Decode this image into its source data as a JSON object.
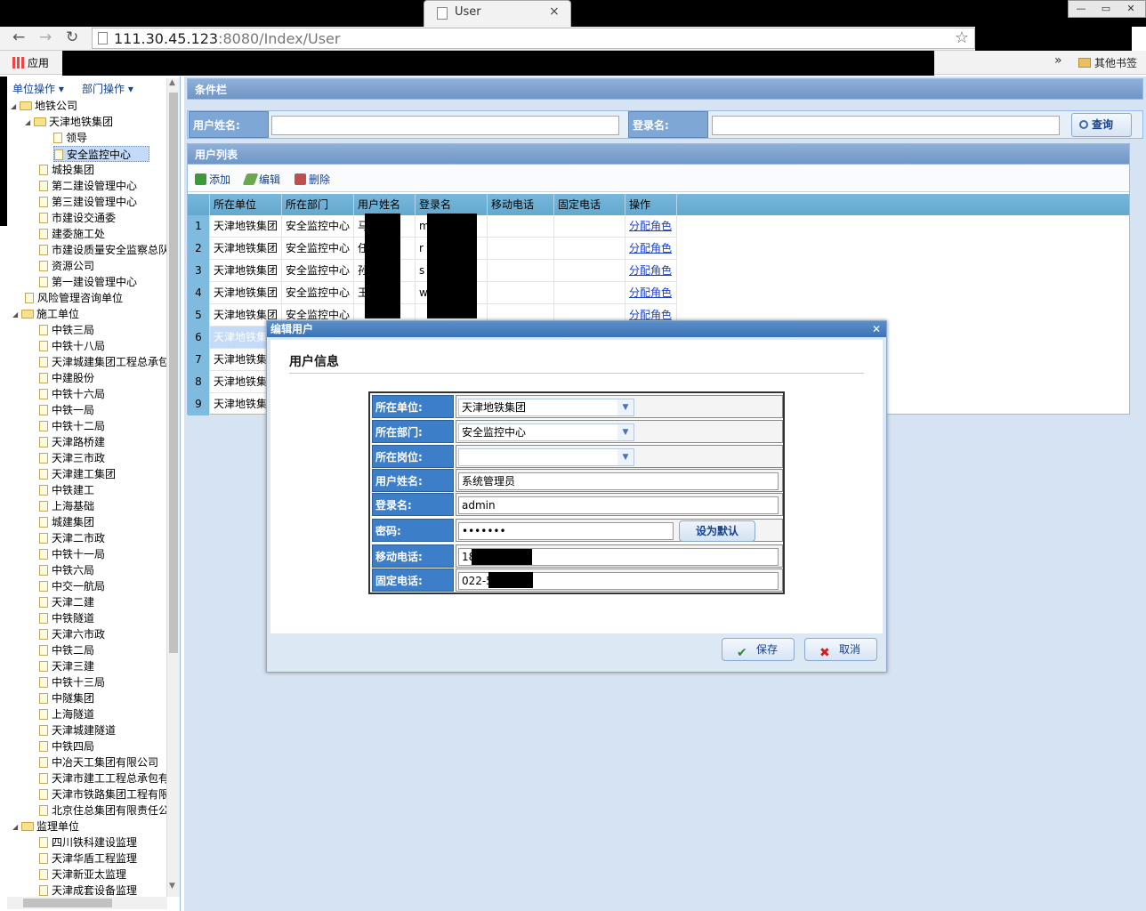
{
  "browser": {
    "tab_title": "User",
    "tab_close": "×",
    "url_host": "111.30.45.123",
    "url_rest": ":8080/Index/User",
    "apps_label": "应用",
    "more": "»",
    "other_bookmarks": "其他书签",
    "win_min": "—",
    "win_max": "▭",
    "win_close": "✕"
  },
  "left": {
    "unit_ops": "单位操作 ▾",
    "dept_ops": "部门操作 ▾",
    "tree": [
      {
        "label": "地铁公司",
        "type": "folder",
        "toggle": "◢"
      },
      {
        "label": "天津地铁集团",
        "type": "folder",
        "toggle": "◢"
      },
      {
        "label": "领导",
        "type": "page"
      },
      {
        "label": "安全监控中心",
        "type": "page",
        "selected": true
      },
      {
        "label": "城投集团",
        "type": "page"
      },
      {
        "label": "第二建设管理中心",
        "type": "page"
      },
      {
        "label": "第三建设管理中心",
        "type": "page"
      },
      {
        "label": "市建设交通委",
        "type": "page"
      },
      {
        "label": "建委施工处",
        "type": "page"
      },
      {
        "label": "市建设质量安全监察总队",
        "type": "page"
      },
      {
        "label": "资源公司",
        "type": "page"
      },
      {
        "label": "第一建设管理中心",
        "type": "page"
      },
      {
        "label": "风险管理咨询单位",
        "type": "page"
      },
      {
        "label": "施工单位",
        "type": "folder",
        "toggle": "◢"
      },
      {
        "label": "中铁三局",
        "type": "page"
      },
      {
        "label": "中铁十八局",
        "type": "page"
      },
      {
        "label": "天津城建集团工程总承包",
        "type": "page"
      },
      {
        "label": "中建股份",
        "type": "page"
      },
      {
        "label": "中铁十六局",
        "type": "page"
      },
      {
        "label": "中铁一局",
        "type": "page"
      },
      {
        "label": "中铁十二局",
        "type": "page"
      },
      {
        "label": "天津路桥建",
        "type": "page"
      },
      {
        "label": "天津三市政",
        "type": "page"
      },
      {
        "label": "天津建工集团",
        "type": "page"
      },
      {
        "label": "中铁建工",
        "type": "page"
      },
      {
        "label": "上海基础",
        "type": "page"
      },
      {
        "label": "城建集团",
        "type": "page"
      },
      {
        "label": "天津二市政",
        "type": "page"
      },
      {
        "label": "中铁十一局",
        "type": "page"
      },
      {
        "label": "中铁六局",
        "type": "page"
      },
      {
        "label": "中交一航局",
        "type": "page"
      },
      {
        "label": "天津二建",
        "type": "page"
      },
      {
        "label": "中铁隧道",
        "type": "page"
      },
      {
        "label": "天津六市政",
        "type": "page"
      },
      {
        "label": "中铁二局",
        "type": "page"
      },
      {
        "label": "天津三建",
        "type": "page"
      },
      {
        "label": "中铁十三局",
        "type": "page"
      },
      {
        "label": "中隧集团",
        "type": "page"
      },
      {
        "label": "上海隧道",
        "type": "page"
      },
      {
        "label": "天津城建隧道",
        "type": "page"
      },
      {
        "label": "中铁四局",
        "type": "page"
      },
      {
        "label": "中冶天工集团有限公司",
        "type": "page"
      },
      {
        "label": "天津市建工工程总承包有",
        "type": "page"
      },
      {
        "label": "天津市铁路集团工程有限",
        "type": "page"
      },
      {
        "label": "北京住总集团有限责任公",
        "type": "page"
      },
      {
        "label": "监理单位",
        "type": "folder",
        "toggle": "◢"
      },
      {
        "label": "四川铁科建设监理",
        "type": "page"
      },
      {
        "label": "天津华盾工程监理",
        "type": "page"
      },
      {
        "label": "天津新亚太监理",
        "type": "page"
      },
      {
        "label": "天津成套设备监理",
        "type": "page"
      }
    ]
  },
  "conditions": {
    "title": "条件栏",
    "name_label": "用户姓名:",
    "name_value": "",
    "login_label": "登录名:",
    "login_value": "",
    "search_label": "查询"
  },
  "grid": {
    "title": "用户列表",
    "add": "添加",
    "edit": "编辑",
    "delete": "删除",
    "columns": [
      "所在单位",
      "所在部门",
      "用户姓名",
      "登录名",
      "移动电话",
      "固定电话",
      "操作"
    ],
    "rows": [
      {
        "n": "1",
        "unit": "天津地铁集团",
        "dept": "安全监控中心",
        "name": "马",
        "login": "m",
        "mobile": "",
        "phone": "",
        "op": "分配角色"
      },
      {
        "n": "2",
        "unit": "天津地铁集团",
        "dept": "安全监控中心",
        "name": "任",
        "login": "r",
        "mobile": "",
        "phone": "",
        "op": "分配角色"
      },
      {
        "n": "3",
        "unit": "天津地铁集团",
        "dept": "安全监控中心",
        "name": "孙",
        "login": "s",
        "mobile": "",
        "phone": "",
        "op": "分配角色"
      },
      {
        "n": "4",
        "unit": "天津地铁集团",
        "dept": "安全监控中心",
        "name": "王",
        "login": "w",
        "mobile": "",
        "phone": "",
        "op": "分配角色"
      },
      {
        "n": "5",
        "unit": "天津地铁集团",
        "dept": "安全监控中心",
        "name": "",
        "login": "",
        "mobile": "",
        "phone": "",
        "op": "分配角色"
      },
      {
        "n": "6",
        "unit": "天津地铁集",
        "dept": "",
        "name": "",
        "login": "",
        "mobile": "",
        "phone": "",
        "op": ""
      },
      {
        "n": "7",
        "unit": "天津地铁集",
        "dept": "",
        "name": "",
        "login": "",
        "mobile": "",
        "phone": "",
        "op": ""
      },
      {
        "n": "8",
        "unit": "天津地铁集",
        "dept": "",
        "name": "",
        "login": "",
        "mobile": "",
        "phone": "",
        "op": ""
      },
      {
        "n": "9",
        "unit": "天津地铁集",
        "dept": "",
        "name": "",
        "login": "",
        "mobile": "",
        "phone": "",
        "op": ""
      }
    ]
  },
  "dialog": {
    "title": "编辑用户",
    "close": "✕",
    "section": "用户信息",
    "unit_label": "所在单位:",
    "unit_value": "天津地铁集团",
    "dept_label": "所在部门:",
    "dept_value": "安全监控中心",
    "post_label": "所在岗位:",
    "post_value": "",
    "name_label": "用户姓名:",
    "name_value": "系统管理员",
    "login_label": "登录名:",
    "login_value": "admin",
    "pwd_label": "密码:",
    "pwd_value": "•••••••",
    "default_btn": "设为默认",
    "mobile_label": "移动电话:",
    "mobile_value": "18",
    "phone_label": "固定电话:",
    "phone_value": "022-58",
    "save": "保存",
    "cancel": "取消",
    "dropdown_arrow": "▼"
  }
}
